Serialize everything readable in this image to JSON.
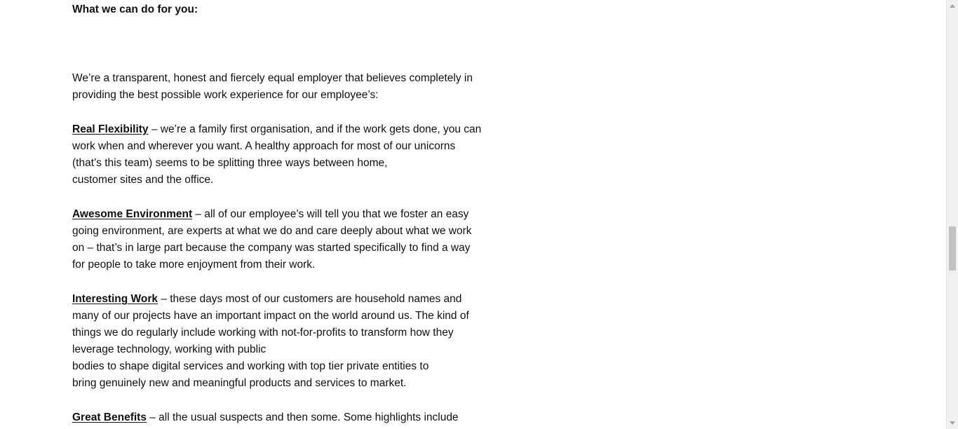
{
  "heading": "What we can do for you:",
  "intro": {
    "lines": [
      "We’re a transparent, honest and fiercely equal employer that believes completely in",
      "providing the best possible work experience for our employee’s:"
    ]
  },
  "sections": [
    {
      "term": "Real Flexibility",
      "lines": [
        " – we’re a family first organisation, and if the work gets done, you can",
        "work when and wherever you want. A healthy approach for most of our unicorns",
        "(that’s this team) seems to be splitting three ways between home,",
        "customer sites and the office."
      ]
    },
    {
      "term": "Awesome Environment",
      "lines": [
        " – all of our employee’s will tell you that we foster an easy",
        "going environment, are experts at what we do and care deeply about what we work",
        "on – that’s in large part because the company was started specifically to find a way",
        "for people to take more enjoyment from their work."
      ]
    },
    {
      "term": "Interesting Work",
      "lines": [
        " – these days most of our customers are household names and",
        "many of our projects have an important impact on the world around us. The kind of",
        "things we do regularly include working with not-for-profits to transform how they",
        "leverage technology, working with public",
        "bodies to shape digital services and working with top tier private entities to",
        "bring genuinely new and meaningful products and services to market."
      ]
    },
    {
      "term": "Great Benefits",
      "lines": [
        " – all the usual suspects and then some. Some highlights include"
      ]
    }
  ],
  "scrollbar": {
    "up_icon": "triangle-up-icon",
    "down_icon": "triangle-down-icon",
    "position": 0.55
  }
}
